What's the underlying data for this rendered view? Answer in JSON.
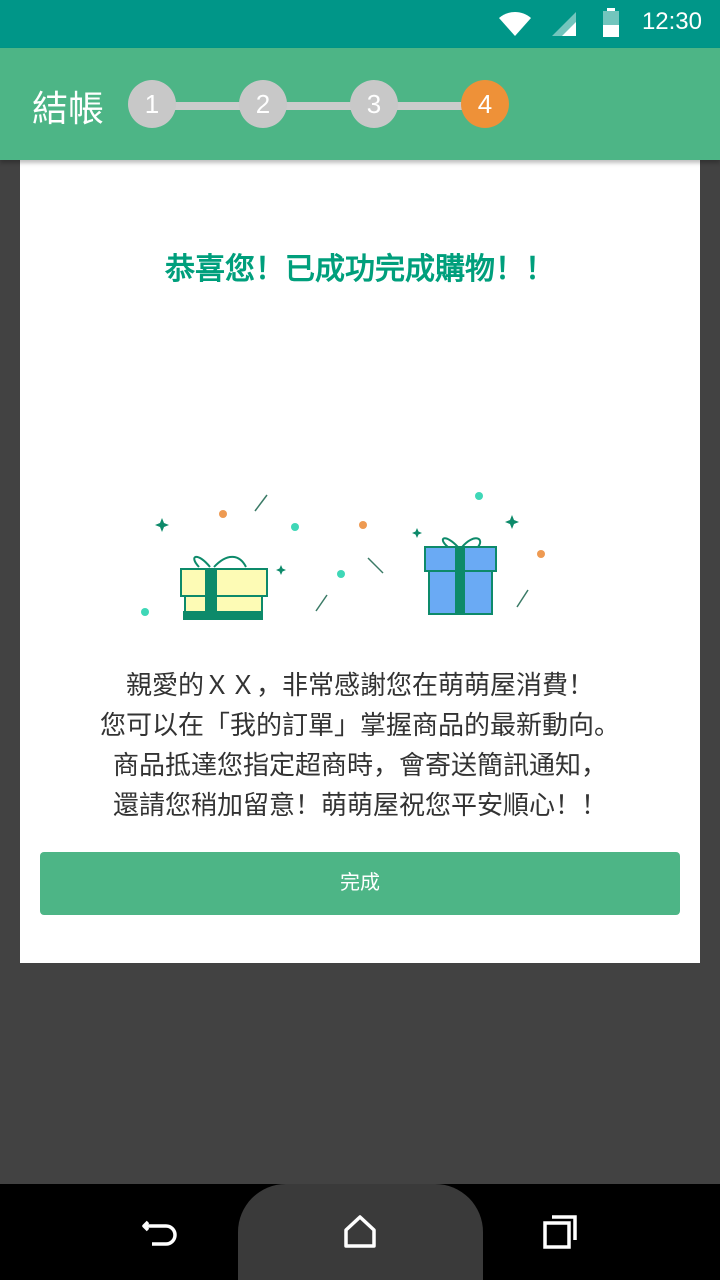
{
  "status_bar": {
    "time": "12:30",
    "icons": [
      "wifi-icon",
      "signal-icon",
      "battery-icon"
    ]
  },
  "app_bar": {
    "title": "結帳",
    "steps": [
      "1",
      "2",
      "3",
      "4"
    ],
    "active_step": "4"
  },
  "content": {
    "headline": "恭喜您！已成功完成購物！！",
    "message_lines": [
      "親愛的ＸＸ，非常感謝您在萌萌屋消費！",
      "您可以在「我的訂單」掌握商品的最新動向。",
      "商品抵達您指定超商時，會寄送簡訊通知，",
      "還請您稍加留意！萌萌屋祝您平安順心！！"
    ],
    "done_button": "完成"
  },
  "nav_bar": {
    "buttons": [
      "back-icon",
      "home-icon",
      "recents-icon"
    ]
  },
  "colors": {
    "status_bar": "#009688",
    "app_bar": "#4db586",
    "active_step": "#ee9138",
    "inactive_step": "#c8c8c8",
    "headline": "#009f7c",
    "button": "#4db586",
    "backdrop": "#424242"
  }
}
